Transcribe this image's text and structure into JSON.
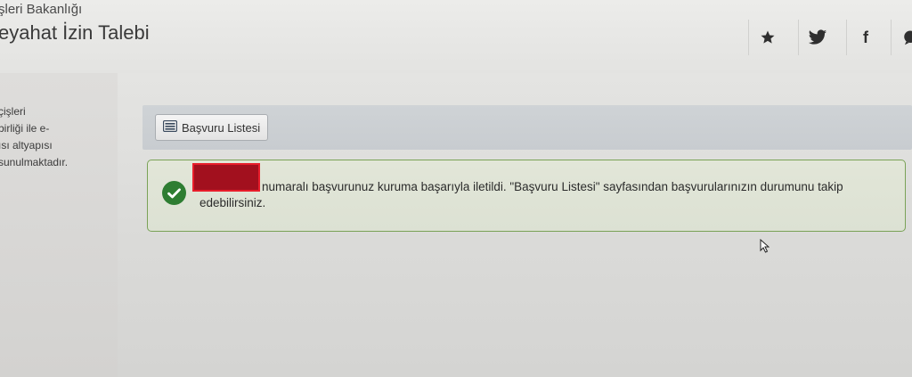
{
  "header": {
    "org_name": "şleri Bakanlığı",
    "page_title": "eyahat İzin Talebi",
    "social_buttons": [
      {
        "icon": "star-icon"
      },
      {
        "icon": "twitter-icon"
      },
      {
        "icon": "facebook-icon",
        "label": "f"
      },
      {
        "icon": "chat-icon"
      }
    ]
  },
  "sidebar": {
    "text": "çişleri\nbirliği ile e-\nısı altyapısı\nsunulmaktadır."
  },
  "toolbar": {
    "list_button_label": "Başvuru Listesi",
    "list_button_icon": "list-icon"
  },
  "alert": {
    "status_icon": "check-circle-icon",
    "status_color": "#2e7d32",
    "redaction_color": "#a2101e",
    "message_line1": "numaralı başvurunuz kuruma başarıyla iletildi. \"Başvuru Listesi\" sayfasından başvurularınızın durumunu takip",
    "message_line2": "edebilirsiniz."
  }
}
